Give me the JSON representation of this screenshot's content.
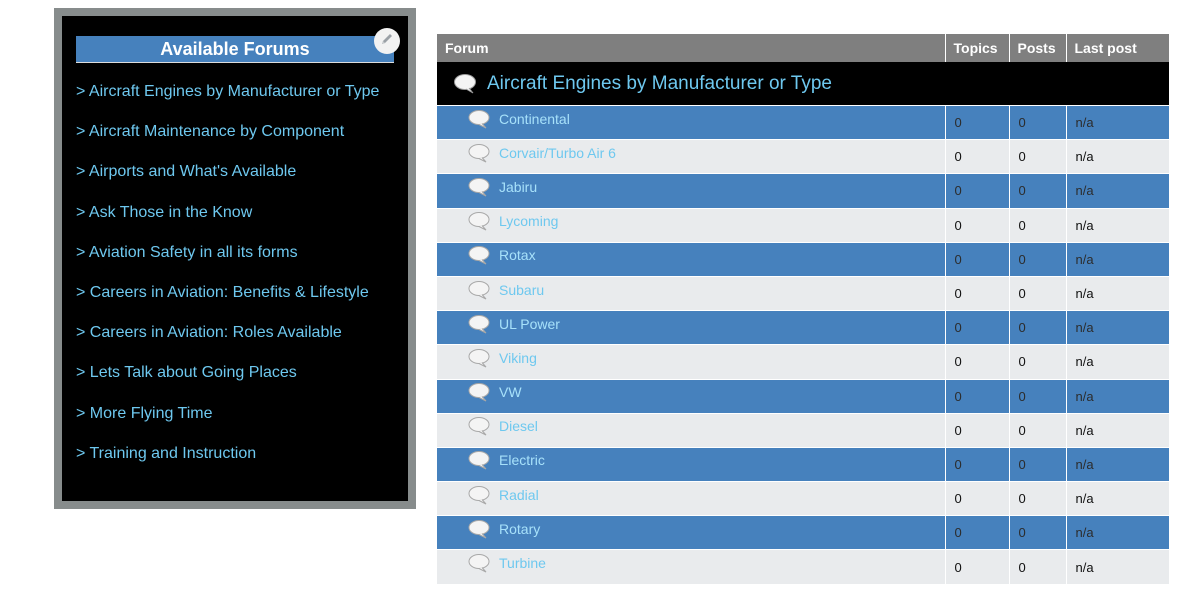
{
  "sidebar": {
    "title": "Available Forums",
    "edit_icon": "pencil-icon",
    "items": [
      {
        "label": "> Aircraft Engines by Manufacturer or Type"
      },
      {
        "label": "> Aircraft Maintenance by Component"
      },
      {
        "label": "> Airports and What's Available"
      },
      {
        "label": "> Ask Those in the Know"
      },
      {
        "label": "> Aviation Safety in all its forms"
      },
      {
        "label": "> Careers in Aviation: Benefits & Lifestyle"
      },
      {
        "label": "> Careers in Aviation: Roles Available"
      },
      {
        "label": "> Lets Talk about Going Places"
      },
      {
        "label": "> More Flying Time"
      },
      {
        "label": "> Training and Instruction"
      }
    ]
  },
  "table": {
    "headers": {
      "forum": "Forum",
      "topics": "Topics",
      "posts": "Posts",
      "last_post": "Last post"
    },
    "category": {
      "title": "Aircraft Engines by Manufacturer or Type",
      "icon": "speech-bubble-icon"
    },
    "rows": [
      {
        "name": "Continental",
        "topics": "0",
        "posts": "0",
        "last": "n/a"
      },
      {
        "name": "Corvair/Turbo Air 6",
        "topics": "0",
        "posts": "0",
        "last": "n/a"
      },
      {
        "name": "Jabiru",
        "topics": "0",
        "posts": "0",
        "last": "n/a"
      },
      {
        "name": "Lycoming",
        "topics": "0",
        "posts": "0",
        "last": "n/a"
      },
      {
        "name": "Rotax",
        "topics": "0",
        "posts": "0",
        "last": "n/a"
      },
      {
        "name": "Subaru",
        "topics": "0",
        "posts": "0",
        "last": "n/a"
      },
      {
        "name": "UL Power",
        "topics": "0",
        "posts": "0",
        "last": "n/a"
      },
      {
        "name": "Viking",
        "topics": "0",
        "posts": "0",
        "last": "n/a"
      },
      {
        "name": "VW",
        "topics": "0",
        "posts": "0",
        "last": "n/a"
      },
      {
        "name": "Diesel",
        "topics": "0",
        "posts": "0",
        "last": "n/a"
      },
      {
        "name": "Electric",
        "topics": "0",
        "posts": "0",
        "last": "n/a"
      },
      {
        "name": "Radial",
        "topics": "0",
        "posts": "0",
        "last": "n/a"
      },
      {
        "name": "Rotary",
        "topics": "0",
        "posts": "0",
        "last": "n/a"
      },
      {
        "name": "Turbine",
        "topics": "0",
        "posts": "0",
        "last": "n/a"
      }
    ]
  },
  "colors": {
    "accent_blue": "#4681bd",
    "link": "#6ec8ef",
    "header_gray": "#7f7f7f",
    "row_light": "#e9ebed"
  }
}
